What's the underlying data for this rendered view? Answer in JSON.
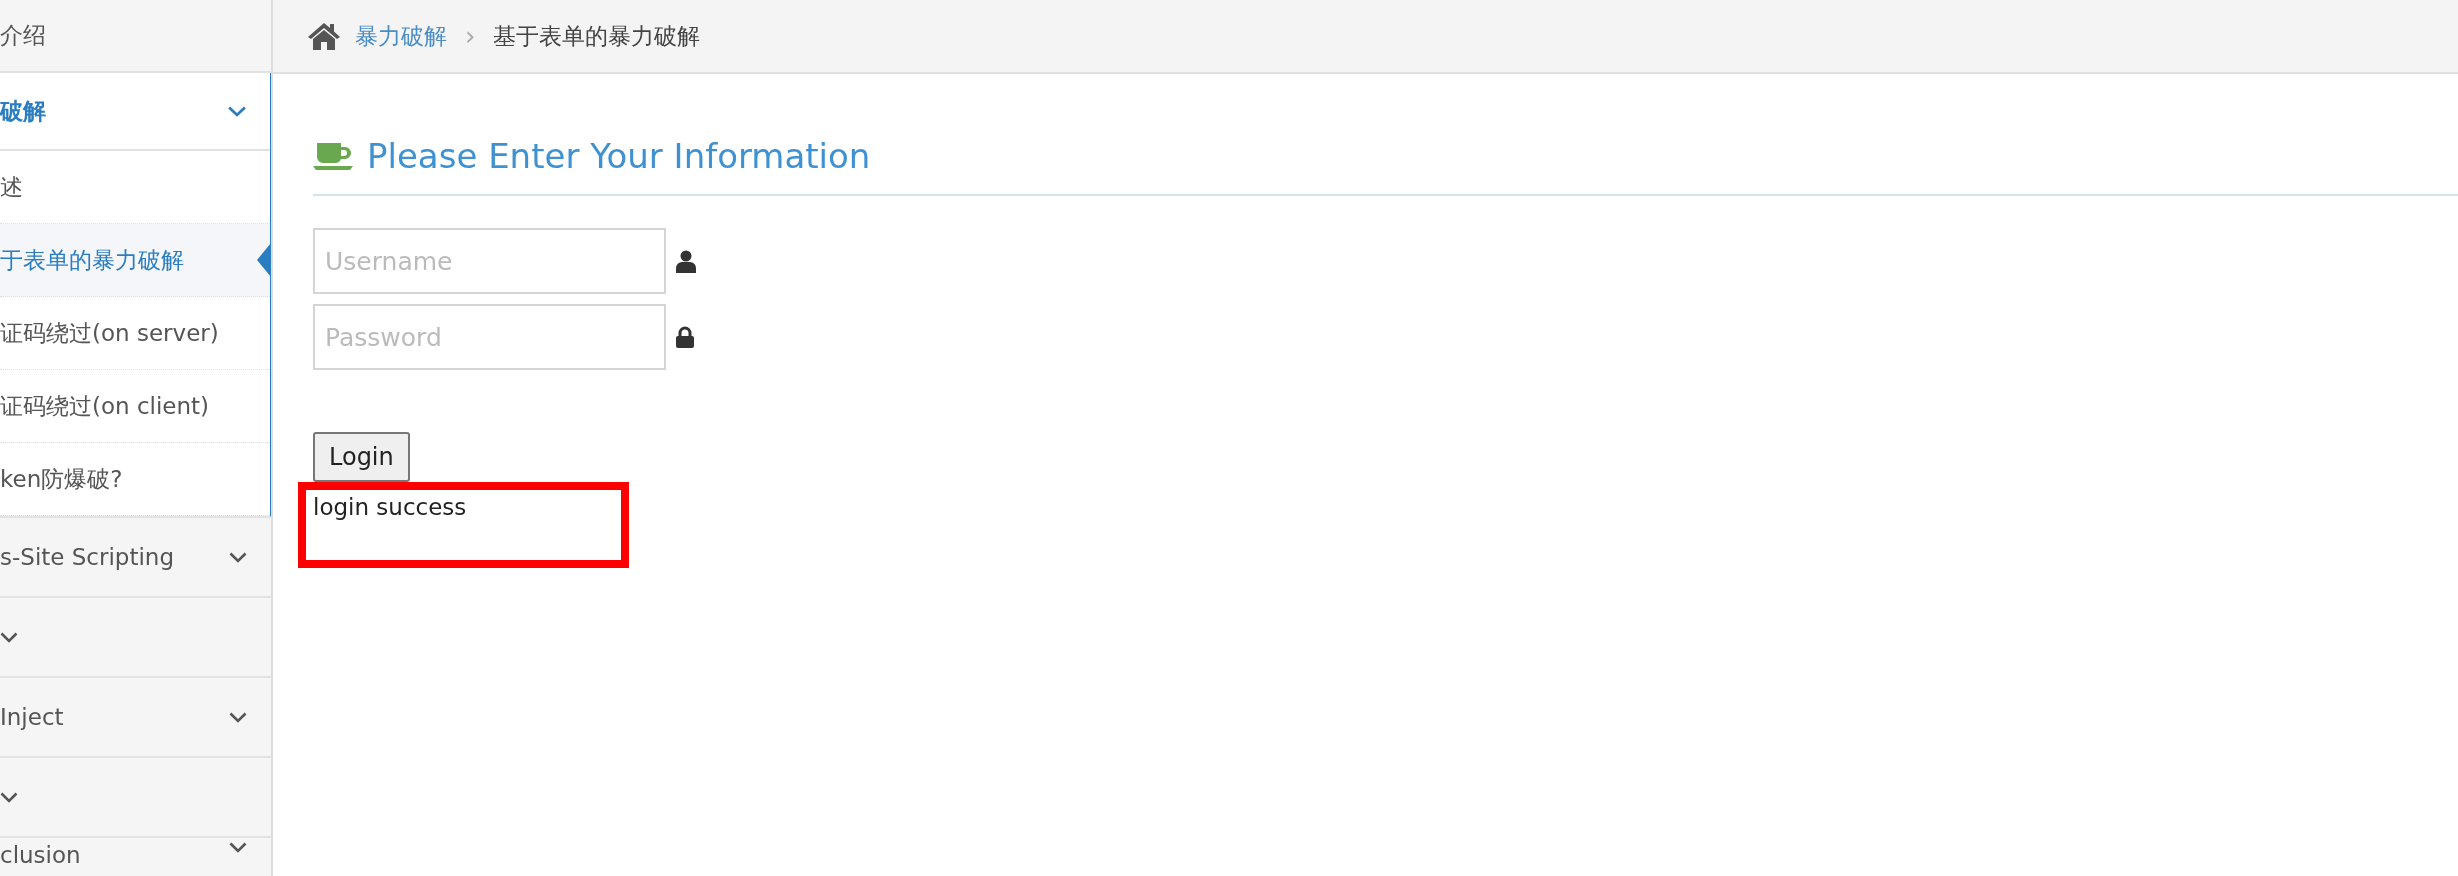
{
  "sidebar": {
    "items": [
      {
        "label": "介绍",
        "kind": "link"
      },
      {
        "label": "破解",
        "kind": "group",
        "expanded": true,
        "children": [
          {
            "label": "述",
            "selected": false
          },
          {
            "label": "于表单的暴力破解",
            "selected": true
          },
          {
            "label": "证码绕过(on server)",
            "selected": false
          },
          {
            "label": "证码绕过(on client)",
            "selected": false
          },
          {
            "label": "ken防爆破?",
            "selected": false
          }
        ]
      },
      {
        "label": "s-Site Scripting",
        "kind": "group",
        "expanded": false
      },
      {
        "kind": "group",
        "expanded": false
      },
      {
        "label": "Inject",
        "kind": "group",
        "expanded": false
      },
      {
        "kind": "group",
        "expanded": false
      },
      {
        "label": "clusion",
        "kind": "group",
        "expanded": false
      }
    ]
  },
  "breadcrumb": {
    "parent": "暴力破解",
    "separator": "›",
    "current": "基于表单的暴力破解"
  },
  "form": {
    "title": "Please Enter Your Information",
    "fields": [
      {
        "kind": "user",
        "placeholder": "Username"
      },
      {
        "kind": "lock",
        "placeholder": "Password"
      }
    ],
    "button": "Login",
    "message": "login success"
  }
}
